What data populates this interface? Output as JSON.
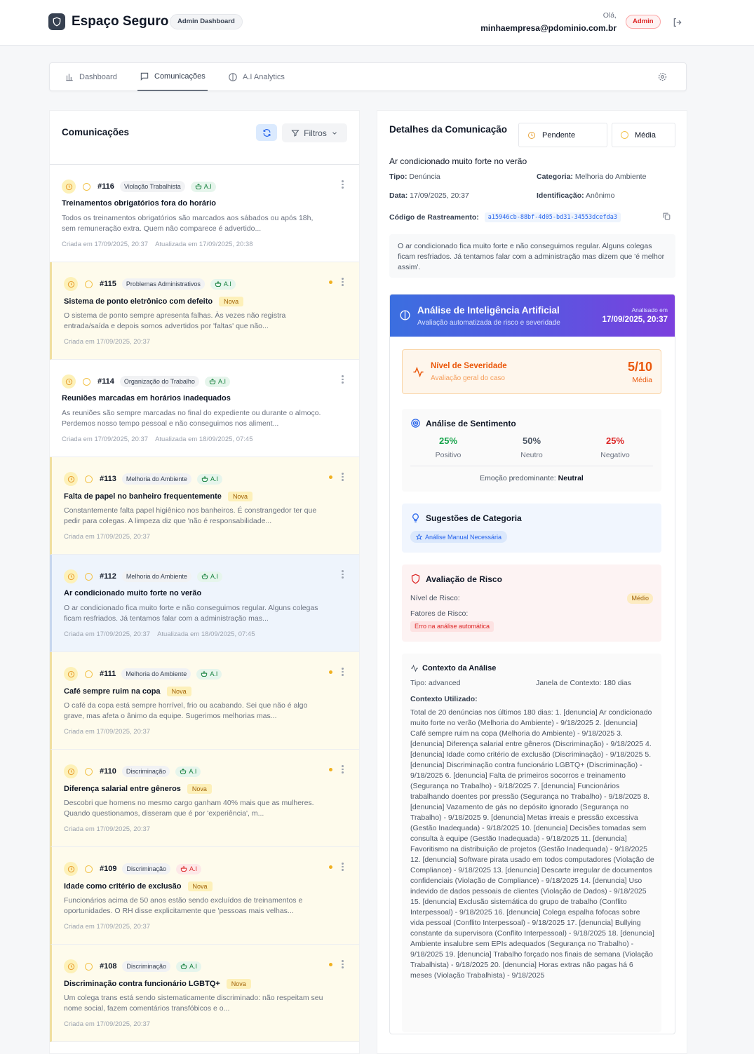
{
  "header": {
    "brand": "Espaço Seguro",
    "admin_pill": "Admin Dashboard",
    "greeting": "Olá,",
    "email": "minhaempresa@pdominio.com.br",
    "role": "Admin"
  },
  "nav": {
    "tabs": [
      {
        "label": "Dashboard",
        "icon": "bar-chart-icon",
        "active": false
      },
      {
        "label": "Comunicações",
        "icon": "message-square-icon",
        "active": true
      },
      {
        "label": "A.I Analytics",
        "icon": "brain-icon",
        "active": false
      }
    ]
  },
  "list": {
    "title": "Comunicações",
    "filter_label": "Filtros",
    "items": [
      {
        "id": "#116",
        "category": "Violação Trabalhista",
        "ai": "A.I",
        "ai_color": "green",
        "title": "Treinamentos obrigatórios fora do horário",
        "nova": "",
        "desc": "Todos os treinamentos obrigatórios são marcados aos sábados ou após 18h, sem remuneração extra. Quem não comparece é advertido...",
        "created": "Criada em 17/09/2025, 20:37",
        "updated": "Atualizada em 17/09/2025, 20:38",
        "state": "normal"
      },
      {
        "id": "#115",
        "category": "Problemas Administrativos",
        "ai": "A.I",
        "ai_color": "green",
        "title": "Sistema de ponto eletrônico com defeito",
        "nova": "Nova",
        "desc": "O sistema de ponto sempre apresenta falhas. Às vezes não registra entrada/saída e depois somos advertidos por 'faltas' que não...",
        "created": "Criada em 17/09/2025, 20:37",
        "updated": "",
        "state": "nova"
      },
      {
        "id": "#114",
        "category": "Organização do Trabalho",
        "ai": "A.I",
        "ai_color": "green",
        "title": "Reuniões marcadas em horários inadequados",
        "nova": "",
        "desc": "As reuniões são sempre marcadas no final do expediente ou durante o almoço. Perdemos nosso tempo pessoal e não conseguimos nos aliment...",
        "created": "Criada em 17/09/2025, 20:37",
        "updated": "Atualizada em 18/09/2025, 07:45",
        "state": "normal"
      },
      {
        "id": "#113",
        "category": "Melhoria do Ambiente",
        "ai": "A.I",
        "ai_color": "green",
        "title": "Falta de papel no banheiro frequentemente",
        "nova": "Nova",
        "desc": "Constantemente falta papel higiênico nos banheiros. É constrangedor ter que pedir para colegas. A limpeza diz que 'não é responsabilidade...",
        "created": "Criada em 17/09/2025, 20:37",
        "updated": "",
        "state": "nova"
      },
      {
        "id": "#112",
        "category": "Melhoria do Ambiente",
        "ai": "A.I",
        "ai_color": "green",
        "title": "Ar condicionado muito forte no verão",
        "nova": "",
        "desc": "O ar condicionado fica muito forte e não conseguimos regular. Alguns colegas ficam resfriados. Já tentamos falar com a administração mas...",
        "created": "Criada em 17/09/2025, 20:37",
        "updated": "Atualizada em 18/09/2025, 07:45",
        "state": "sel"
      },
      {
        "id": "#111",
        "category": "Melhoria do Ambiente",
        "ai": "A.I",
        "ai_color": "green",
        "title": "Café sempre ruim na copa",
        "nova": "Nova",
        "desc": "O café da copa está sempre horrível, frio ou acabando. Sei que não é algo grave, mas afeta o ânimo da equipe. Sugerimos melhorias mas...",
        "created": "Criada em 17/09/2025, 20:37",
        "updated": "",
        "state": "nova"
      },
      {
        "id": "#110",
        "category": "Discriminação",
        "ai": "A.I",
        "ai_color": "green",
        "title": "Diferença salarial entre gêneros",
        "nova": "Nova",
        "desc": "Descobri que homens no mesmo cargo ganham 40% mais que as mulheres. Quando questionamos, disseram que é por 'experiência', m...",
        "created": "Criada em 17/09/2025, 20:37",
        "updated": "",
        "state": "nova"
      },
      {
        "id": "#109",
        "category": "Discriminação",
        "ai": "A.I",
        "ai_color": "red",
        "title": "Idade como critério de exclusão",
        "nova": "Nova",
        "desc": "Funcionários acima de 50 anos estão sendo excluídos de treinamentos e oportunidades. O RH disse explicitamente que 'pessoas mais velhas...",
        "created": "Criada em 17/09/2025, 20:37",
        "updated": "",
        "state": "nova"
      },
      {
        "id": "#108",
        "category": "Discriminação",
        "ai": "A.I",
        "ai_color": "green",
        "title": "Discriminação contra funcionário LGBTQ+",
        "nova": "Nova",
        "desc": "Um colega trans está sendo sistematicamente discriminado: não respeitam seu nome social, fazem comentários transfóbicos e o...",
        "created": "Criada em 17/09/2025, 20:37",
        "updated": "",
        "state": "nova"
      }
    ]
  },
  "detail": {
    "title": "Detalhes da Comunicação",
    "status": "Pendente",
    "priority": "Média",
    "subject": "Ar condicionado muito forte no verão",
    "tipo_k": "Tipo:",
    "tipo_v": " Denúncia",
    "cat_k": "Categoria:",
    "cat_v": " Melhoria do Ambiente",
    "data_k": "Data:",
    "data_v": " 17/09/2025, 20:37",
    "id_k": "Identificação:",
    "id_v": " Anônimo",
    "track_k": "Código de Rastreamento:",
    "track_v": "a15946cb-88bf-4d05-bd31-34553dcefda3",
    "description": "O ar condicionado fica muito forte e não conseguimos regular. Alguns colegas ficam resfriados. Já tentamos falar com a administração mas dizem que 'é melhor assim'."
  },
  "ai": {
    "title": "Análise de Inteligência Artificial",
    "subtitle": "Avaliação automatizada de risco e severidade",
    "analyzed_label": "Analisado em",
    "analyzed_at": "17/09/2025, 20:37",
    "severity_title": "Nível de Severidade",
    "severity_sub": "Avaliação geral do caso",
    "severity_value": "5/10",
    "severity_level": "Média",
    "sentiment_title": "Análise de Sentimento",
    "sentiments": [
      {
        "pct": "25%",
        "label": "Positivo",
        "color": "#16a34a"
      },
      {
        "pct": "50%",
        "label": "Neutro",
        "color": "#4b5563"
      },
      {
        "pct": "25%",
        "label": "Negativo",
        "color": "#dc2626"
      }
    ],
    "emotion_label": "Emoção predominante:",
    "emotion_value": "Neutral",
    "suggest_title": "Sugestões de Categoria",
    "suggest_pill": "Análise Manual Necessária",
    "risk_title": "Avaliação de Risco",
    "risk_level_label": "Nível de Risco:",
    "risk_level": "Médio",
    "risk_factors_label": "Fatores de Risco:",
    "risk_error": "Erro na análise automática",
    "ctx_title": "Contexto da Análise",
    "ctx_tipo": "Tipo: advanced",
    "ctx_window": "Janela de Contexto: 180 dias",
    "ctx_used": "Contexto Utilizado:",
    "ctx_text": "Total de 20 denúncias nos últimos 180 dias: 1. [denuncia] Ar condicionado muito forte no verão (Melhoria do Ambiente) - 9/18/2025 2. [denuncia] Café sempre ruim na copa (Melhoria do Ambiente) - 9/18/2025 3. [denuncia] Diferença salarial entre gêneros (Discriminação) - 9/18/2025 4. [denuncia] Idade como critério de exclusão (Discriminação) - 9/18/2025 5. [denuncia] Discriminação contra funcionário LGBTQ+ (Discriminação) - 9/18/2025 6. [denuncia] Falta de primeiros socorros e treinamento (Segurança no Trabalho) - 9/18/2025 7. [denuncia] Funcionários trabalhando doentes por pressão (Segurança no Trabalho) - 9/18/2025 8. [denuncia] Vazamento de gás no depósito ignorado (Segurança no Trabalho) - 9/18/2025 9. [denuncia] Metas irreais e pressão excessiva (Gestão Inadequada) - 9/18/2025 10. [denuncia] Decisões tomadas sem consulta à equipe (Gestão Inadequada) - 9/18/2025 11. [denuncia] Favoritismo na distribuição de projetos (Gestão Inadequada) - 9/18/2025 12. [denuncia] Software pirata usado em todos computadores (Violação de Compliance) - 9/18/2025 13. [denuncia] Descarte irregular de documentos confidenciais (Violação de Compliance) - 9/18/2025 14. [denuncia] Uso indevido de dados pessoais de clientes (Violação de Dados) - 9/18/2025 15. [denuncia] Exclusão sistemática do grupo de trabalho (Conflito Interpessoal) - 9/18/2025 16. [denuncia] Colega espalha fofocas sobre vida pessoal (Conflito Interpessoal) - 9/18/2025 17. [denuncia] Bullying constante da supervisora (Conflito Interpessoal) - 9/18/2025 18. [denuncia] Ambiente insalubre sem EPIs adequados (Segurança no Trabalho) - 9/18/2025 19. [denuncia] Trabalho forçado nos finais de semana (Violação Trabalhista) - 9/18/2025 20. [denuncia] Horas extras não pagas há 6 meses (Violação Trabalhista) - 9/18/2025"
  },
  "colors": {
    "accent": "#2563eb",
    "nova_bg": "#fefbec",
    "selected_bg": "#eef4fc",
    "ai_gradient_start": "#3b6fe0",
    "ai_gradient_end": "#7c3fde"
  }
}
